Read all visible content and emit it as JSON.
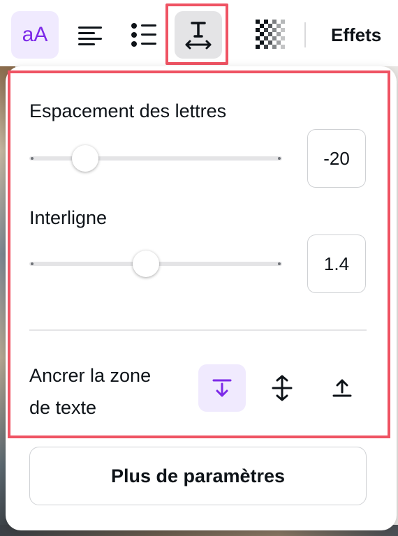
{
  "toolbar": {
    "font_button_label": "aA",
    "effects_label": "Effets",
    "icons": [
      "font-size-icon",
      "align-left-icon",
      "list-icon",
      "spacing-icon",
      "transparency-icon"
    ]
  },
  "panel": {
    "letter_spacing": {
      "label": "Espacement des lettres",
      "value": "-20",
      "slider_fraction": 0.22
    },
    "line_height": {
      "label": "Interligne",
      "value": "1.4",
      "slider_fraction": 0.46
    },
    "anchor": {
      "label_line1": "Ancrer la zone",
      "label_line2": "de texte",
      "options": [
        "anchor-top-icon",
        "anchor-middle-icon",
        "anchor-bottom-icon"
      ],
      "selected": "anchor-top-icon"
    },
    "more_button_label": "Plus de paramètres"
  },
  "colors": {
    "accent": "#7d2ae8",
    "accent_bg": "#f0eafe",
    "highlight": "#ef5363",
    "text": "#0e1318"
  }
}
